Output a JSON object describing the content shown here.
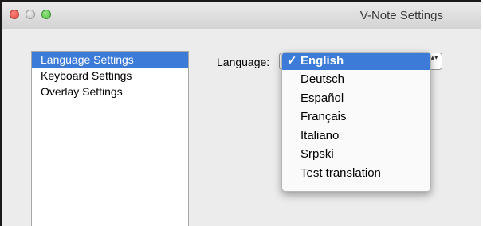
{
  "window": {
    "title": "V-Note Settings"
  },
  "sidebar": {
    "items": [
      {
        "label": "Language Settings",
        "selected": true
      },
      {
        "label": "Keyboard Settings",
        "selected": false
      },
      {
        "label": "Overlay Settings",
        "selected": false
      }
    ]
  },
  "language": {
    "label": "Language:",
    "options": [
      {
        "label": "English",
        "selected": true
      },
      {
        "label": "Deutsch"
      },
      {
        "label": "Español"
      },
      {
        "label": "Français"
      },
      {
        "label": "Italiano"
      },
      {
        "label": "Srpski"
      },
      {
        "label": "Test translation"
      }
    ],
    "check_glyph": "✓",
    "arrows_glyph": "▴▾"
  },
  "icons": {
    "close": "close-icon",
    "minimize": "minimize-icon",
    "zoom": "zoom-icon",
    "checkmark": "checkmark-icon",
    "select_arrows": "up-down-arrows-icon"
  },
  "colors": {
    "selection": "#3d7bd9",
    "close": "#e0443b",
    "zoom": "#4cbf3c"
  }
}
